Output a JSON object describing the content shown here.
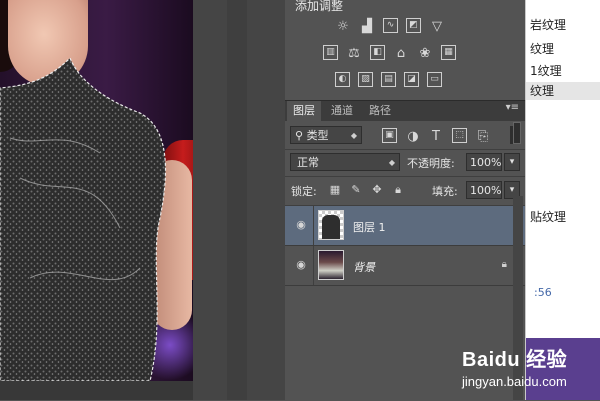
{
  "adjustments": {
    "title": "添加调整",
    "row1_icons": [
      "brightness-icon",
      "levels-icon",
      "curves-icon",
      "exposure-icon",
      "vibrance-icon"
    ],
    "row2_icons": [
      "color-balance-icon",
      "hue-saturation-icon",
      "black-white-icon",
      "photo-filter-icon",
      "channel-mixer-icon",
      "color-lookup-icon"
    ],
    "row3_icons": [
      "invert-icon",
      "posterize-icon",
      "threshold-icon",
      "selective-color-icon",
      "gradient-map-icon"
    ]
  },
  "layers_panel": {
    "tabs": [
      {
        "label": "图层",
        "active": true
      },
      {
        "label": "通道",
        "active": false
      },
      {
        "label": "路径",
        "active": false
      }
    ],
    "filter": {
      "label": "类型",
      "icon": "search-icon"
    },
    "blend_mode": "正常",
    "opacity_label": "不透明度:",
    "opacity_value": "100%",
    "lock_label": "锁定:",
    "fill_label": "填充:",
    "fill_value": "100%",
    "layers": [
      {
        "name": "图层 1",
        "selected": true,
        "visible": true,
        "locked": false
      },
      {
        "name": "背景",
        "selected": false,
        "visible": true,
        "locked": true
      }
    ]
  },
  "right_panel": {
    "items": [
      "岩纹理",
      "纹理",
      "1纹理",
      "纹理",
      "贴纹理"
    ],
    "time": ":56"
  },
  "watermark": {
    "brand": "Baidu",
    "suffix": "经验",
    "url": "jingyan.baidu.com"
  }
}
